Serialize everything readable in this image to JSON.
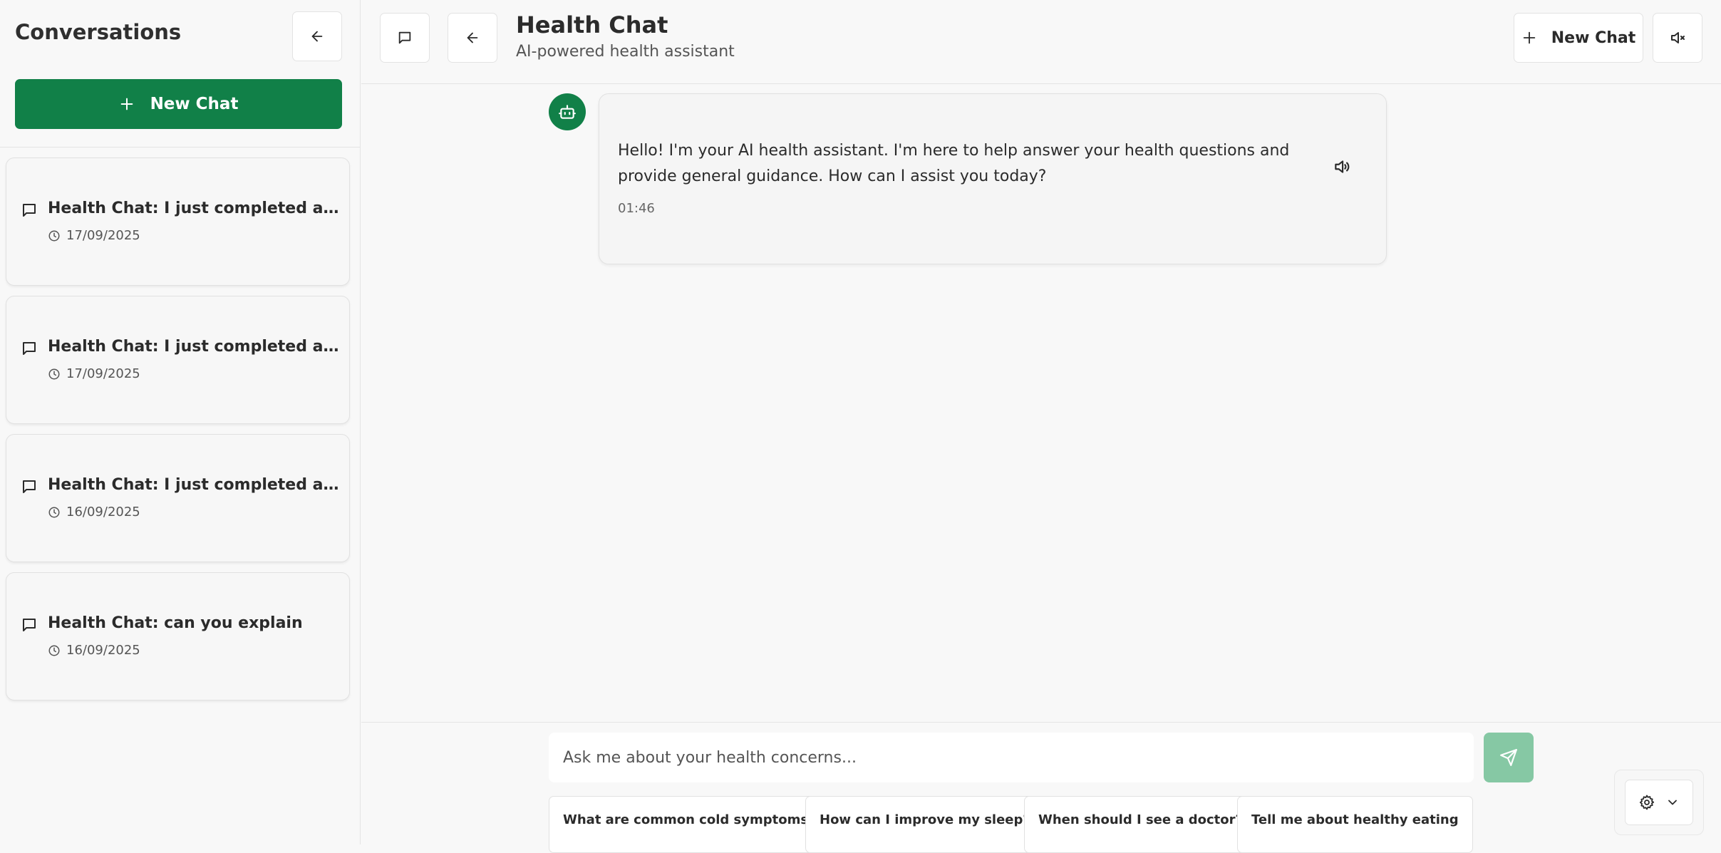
{
  "sidebar": {
    "title": "Conversations",
    "new_chat_label": "New Chat",
    "conversations": [
      {
        "title": "Health Chat: I just completed a skin a...",
        "date": "17/09/2025"
      },
      {
        "title": "Health Chat: I just completed a skin a...",
        "date": "17/09/2025"
      },
      {
        "title": "Health Chat: I just completed a voice ...",
        "date": "16/09/2025"
      },
      {
        "title": "Health Chat: can you explain",
        "date": "16/09/2025"
      }
    ]
  },
  "header": {
    "title": "Health Chat",
    "subtitle": "AI-powered health assistant",
    "new_chat_label": "New Chat"
  },
  "messages": [
    {
      "text": "Hello! I'm your AI health assistant. I'm here to help answer your health questions and provide general guidance. How can I assist you today?",
      "time": "01:46"
    }
  ],
  "input": {
    "placeholder": "Ask me about your health concerns..."
  },
  "suggestions": [
    "What are common cold symptoms?",
    "How can I improve my sleep?",
    "When should I see a doctor?",
    "Tell me about healthy eating"
  ],
  "icons": {
    "collapse": "arrow-left-icon",
    "new_chat": "plus-icon",
    "conversation": "message-square-icon",
    "date": "clock-icon",
    "toggle": "message-square-icon",
    "back": "arrow-left-icon",
    "mute": "volume-x-icon",
    "bot": "bot-icon",
    "speak": "volume-icon",
    "send": "send-icon",
    "settings": "gear-icon",
    "dropdown": "chevron-down-icon"
  },
  "colors": {
    "primary": "#118048",
    "send_disabled": "#86c8a4",
    "background": "#f8f8f8",
    "border": "#e4e4e4"
  }
}
